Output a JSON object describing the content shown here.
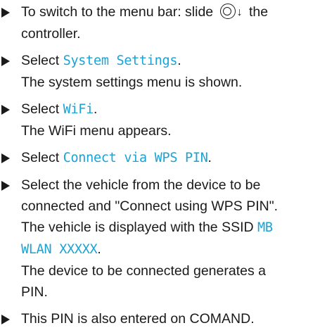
{
  "steps": [
    {
      "pre": "To switch to the menu bar: slide",
      "icon": "controller-ring-icon",
      "arrow": "↓",
      "post": "the",
      "cont": "controller."
    },
    {
      "lead": "Select",
      "hl": "System Settings",
      "tail": ".",
      "result": "The system settings menu is shown."
    },
    {
      "lead": "Select",
      "hl": "WiFi",
      "tail": ".",
      "result": "The WiFi menu appears."
    },
    {
      "lead": "Select",
      "hl": "Connect via WPS PIN",
      "tail": "."
    },
    {
      "l1": "Select the vehicle from the device to be",
      "l2": "connected and \"Connect using WPS PIN\".",
      "l3_pre": "The vehicle is displayed with the SSID",
      "l3_hl": "MB",
      "l4_hl": "WLAN XXXXX",
      "l4_tail": ".",
      "l5": "The device to be connected generates a",
      "l6": "PIN."
    },
    {
      "text": "This PIN is also entered on COMAND."
    }
  ],
  "colors": {
    "text": "#1a1a1a",
    "highlight": "#1aa3d6"
  }
}
